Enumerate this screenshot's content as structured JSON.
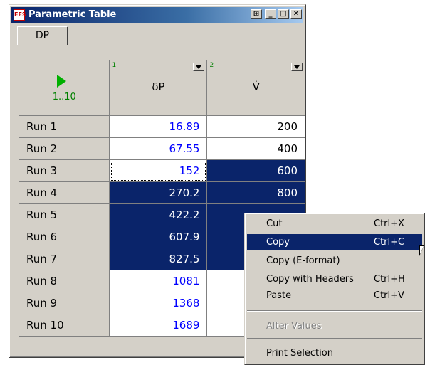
{
  "window": {
    "title": "Parametric Table",
    "icon_label": "EES",
    "buttons": [
      "⊞",
      "_",
      "□",
      "✕"
    ]
  },
  "tabs": [
    {
      "label": "DP"
    }
  ],
  "table": {
    "corner": {
      "icon": "play-icon",
      "range": "1..10"
    },
    "columns": [
      {
        "number": "1",
        "name": "δP"
      },
      {
        "number": "2",
        "name": "V̇"
      }
    ],
    "rows": [
      {
        "label": "Run 1",
        "dp": "16.89",
        "v": "200"
      },
      {
        "label": "Run 2",
        "dp": "67.55",
        "v": "400"
      },
      {
        "label": "Run 3",
        "dp": "152",
        "v": "600"
      },
      {
        "label": "Run 4",
        "dp": "270.2",
        "v": "800"
      },
      {
        "label": "Run 5",
        "dp": "422.2",
        "v": ""
      },
      {
        "label": "Run 6",
        "dp": "607.9",
        "v": ""
      },
      {
        "label": "Run 7",
        "dp": "827.5",
        "v": ""
      },
      {
        "label": "Run 8",
        "dp": "1081",
        "v": ""
      },
      {
        "label": "Run 9",
        "dp": "1368",
        "v": ""
      },
      {
        "label": "Run 10",
        "dp": "1689",
        "v": ""
      }
    ]
  },
  "context_menu": {
    "items": [
      {
        "label": "Cut",
        "shortcut": "Ctrl+X"
      },
      {
        "label": "Copy",
        "shortcut": "Ctrl+C"
      },
      {
        "label": "Copy (E-format)",
        "shortcut": ""
      },
      {
        "label": "Copy with Headers",
        "shortcut": "Ctrl+H"
      },
      {
        "label": "Paste",
        "shortcut": "Ctrl+V"
      },
      {
        "label": "Alter Values",
        "shortcut": ""
      },
      {
        "label": "Print Selection",
        "shortcut": ""
      }
    ]
  },
  "colors": {
    "selection": "#0a246a",
    "calculated_value": "#0000ff",
    "column_number": "#008000"
  }
}
